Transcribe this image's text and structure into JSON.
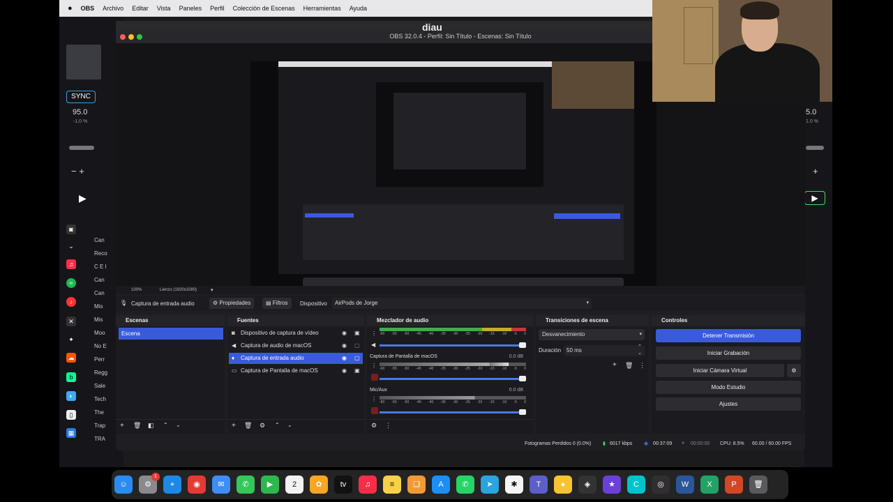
{
  "menubar": {
    "app": "OBS",
    "items": [
      "Archivo",
      "Editar",
      "Vista",
      "Paneles",
      "Perfil",
      "Colección de Escenas",
      "Herramientas",
      "Ayuda"
    ]
  },
  "djay": {
    "sync_label": "SYNC",
    "bpm_left": "95.0",
    "pitch_left": "-1.0 %",
    "bpm_right": "5.0",
    "pitch_right": "1.0 %",
    "library": [
      "Can",
      "Reco",
      "C E I",
      "Can",
      "Can",
      "Mis",
      "Mis",
      "Moo",
      "No E",
      "Perr",
      "Regg",
      "Sale",
      "Tech",
      "The",
      "Trap",
      "TRA"
    ]
  },
  "diau_label": "diau",
  "obs": {
    "window_title": "OBS 32.0.4 - Perfil: Sin Título - Escenas: Sin Título",
    "zoom": "100%",
    "canvas": "Lienzo (1920x1080)",
    "properties_bar": {
      "source": "Captura de entrada audio",
      "properties": "Propiedades",
      "filters": "Filtros",
      "device_label": "Dispositivo",
      "device_value": "AirPods de Jorge"
    },
    "scenes": {
      "title": "Escenas",
      "items": [
        "Escena"
      ]
    },
    "sources": {
      "title": "Fuentes",
      "items": [
        {
          "label": "Dispositivo de captura de vídeo",
          "icon": "camera-icon"
        },
        {
          "label": "Captura de audio de macOS",
          "icon": "speaker-icon"
        },
        {
          "label": "Captura de entrada audio",
          "icon": "mic-icon"
        },
        {
          "label": "Captura de Pantalla de macOS",
          "icon": "monitor-icon"
        }
      ]
    },
    "mixer": {
      "title": "Mezclador de audio",
      "channels": [
        {
          "name": "",
          "db": "",
          "level": 0.9
        },
        {
          "name": "Captura de Pantalla de macOS",
          "db": "0.0 dB",
          "level": 0.9
        },
        {
          "name": "Mic/Aux",
          "db": "0.0 dB",
          "level": 0.9
        }
      ],
      "ticks": [
        "-60",
        "-55",
        "-50",
        "-45",
        "-40",
        "-35",
        "-30",
        "-25",
        "-20",
        "-15",
        "-10",
        "-5",
        "0"
      ]
    },
    "transitions": {
      "title": "Transiciones de escena",
      "type": "Desvanecimiento",
      "duration_label": "Duración",
      "duration_value": "50 ms"
    },
    "controls": {
      "title": "Controles",
      "stop_stream": "Detener Transmisión",
      "start_recording": "Iniciar Grabación",
      "start_virtual_cam": "Iniciar Cámara Virtual",
      "studio_mode": "Modo Estudio",
      "settings": "Ajustes"
    },
    "status": {
      "dropped": "Fotogramas Perdidos 0 (0.0%)",
      "bitrate": "6017 kbps",
      "stream_time": "00:37:09",
      "rec_time": "00:00:00",
      "cpu": "CPU: 8.5%",
      "fps": "60.00 / 60.00 FPS"
    }
  },
  "dock": {
    "apps": [
      {
        "name": "finder-icon",
        "glyph": "☺",
        "color": "#2a8cf0"
      },
      {
        "name": "system-settings-icon",
        "glyph": "⚙",
        "color": "#8a8a8e",
        "badge": "1"
      },
      {
        "name": "safari-icon",
        "glyph": "⌖",
        "color": "#1e88e5"
      },
      {
        "name": "chrome-icon",
        "glyph": "◉",
        "color": "#e53935"
      },
      {
        "name": "mail-icon",
        "glyph": "✉",
        "color": "#3d8ef7"
      },
      {
        "name": "messages-icon",
        "glyph": "✆",
        "color": "#34c759"
      },
      {
        "name": "facetime-icon",
        "glyph": "▶",
        "color": "#2db84d"
      },
      {
        "name": "calendar-icon",
        "glyph": "2",
        "color": "#f2f2f2"
      },
      {
        "name": "photos-icon",
        "glyph": "✿",
        "color": "#f5a623"
      },
      {
        "name": "apple-tv-icon",
        "glyph": "tv",
        "color": "#111111"
      },
      {
        "name": "music-icon",
        "glyph": "♫",
        "color": "#fa2d48"
      },
      {
        "name": "notes-icon",
        "glyph": "≡",
        "color": "#f7d046"
      },
      {
        "name": "books-icon",
        "glyph": "❑",
        "color": "#f09a37"
      },
      {
        "name": "app-store-icon",
        "glyph": "A",
        "color": "#1c8ef9"
      },
      {
        "name": "whatsapp-icon",
        "glyph": "✆",
        "color": "#25d366"
      },
      {
        "name": "telegram-icon",
        "glyph": "➤",
        "color": "#2aa3df"
      },
      {
        "name": "chatgpt-icon",
        "glyph": "✱",
        "color": "#f5f5f5"
      },
      {
        "name": "teams-icon",
        "glyph": "T",
        "color": "#5b5fc7"
      },
      {
        "name": "emoji-icon",
        "glyph": "●",
        "color": "#f7c331"
      },
      {
        "name": "game-controller-icon",
        "glyph": "◈",
        "color": "#333333"
      },
      {
        "name": "imovie-icon",
        "glyph": "★",
        "color": "#6d3fd9"
      },
      {
        "name": "canva-icon",
        "glyph": "C",
        "color": "#00c4cc"
      },
      {
        "name": "obs-icon",
        "glyph": "◎",
        "color": "#302e31"
      },
      {
        "name": "word-icon",
        "glyph": "W",
        "color": "#2b579a"
      },
      {
        "name": "excel-icon",
        "glyph": "X",
        "color": "#21a366"
      },
      {
        "name": "powerpoint-icon",
        "glyph": "P",
        "color": "#d24726"
      },
      {
        "name": "trash-icon",
        "glyph": "🗑",
        "color": "#5a5a5e"
      }
    ]
  }
}
